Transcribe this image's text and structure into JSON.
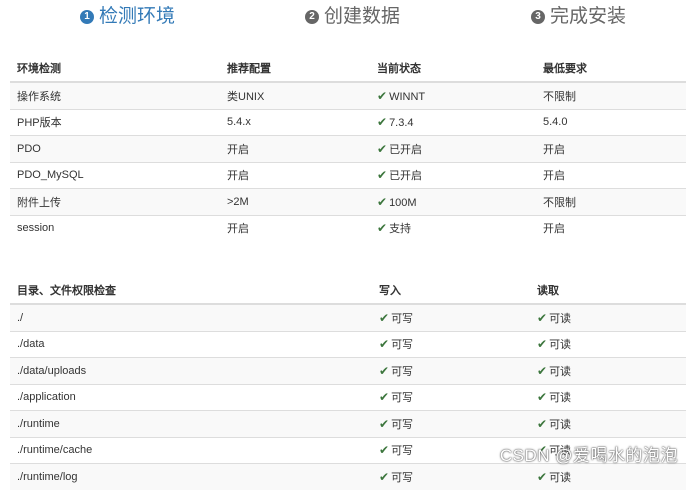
{
  "steps": [
    {
      "number": "1",
      "label": "检测环境"
    },
    {
      "number": "2",
      "label": "创建数据"
    },
    {
      "number": "3",
      "label": "完成安装"
    }
  ],
  "env_table": {
    "headers": [
      "环境检测",
      "推荐配置",
      "当前状态",
      "最低要求"
    ],
    "rows": [
      {
        "name": "操作系统",
        "recommended": "类UNIX",
        "current": "WINNT",
        "minimum": "不限制"
      },
      {
        "name": "PHP版本",
        "recommended": "5.4.x",
        "current": "7.3.4",
        "minimum": "5.4.0"
      },
      {
        "name": "PDO",
        "recommended": "开启",
        "current": "已开启",
        "minimum": "开启"
      },
      {
        "name": "PDO_MySQL",
        "recommended": "开启",
        "current": "已开启",
        "minimum": "开启"
      },
      {
        "name": "附件上传",
        "recommended": ">2M",
        "current": "100M",
        "minimum": "不限制"
      },
      {
        "name": "session",
        "recommended": "开启",
        "current": "支持",
        "minimum": "开启"
      }
    ]
  },
  "dir_table": {
    "headers": [
      "目录、文件权限检查",
      "写入",
      "读取"
    ],
    "rows": [
      {
        "path": "./",
        "write": "可写",
        "read": "可读"
      },
      {
        "path": "./data",
        "write": "可写",
        "read": "可读"
      },
      {
        "path": "./data/uploads",
        "write": "可写",
        "read": "可读"
      },
      {
        "path": "./application",
        "write": "可写",
        "read": "可读"
      },
      {
        "path": "./runtime",
        "write": "可写",
        "read": "可读"
      },
      {
        "path": "./runtime/cache",
        "write": "可写",
        "read": "可读"
      },
      {
        "path": "./runtime/log",
        "write": "可写",
        "read": "可读"
      }
    ]
  },
  "watermark": "CSDN @爱喝水的泡泡",
  "colors": {
    "accent": "#337ab7",
    "inactive": "#666666",
    "success": "#3c763d",
    "border": "#dddddd",
    "stripe": "#f9f9f9"
  },
  "icons": {
    "status": "check-icon"
  }
}
